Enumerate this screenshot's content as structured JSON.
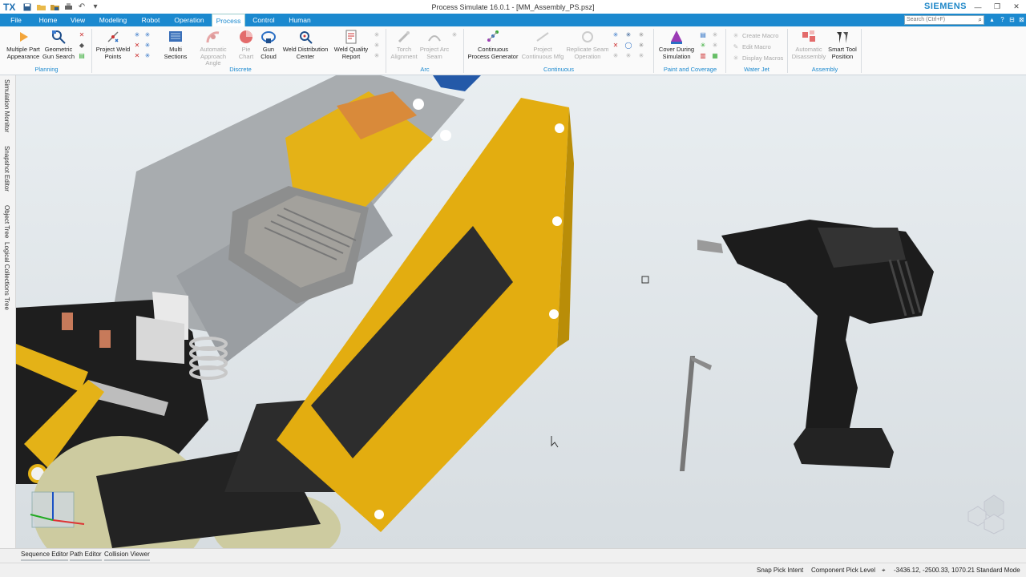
{
  "titlebar": {
    "logo": "TX",
    "window_title": "Process Simulate 16.0.1 - [MM_Assembly_PS.psz]",
    "brand": "SIEMENS"
  },
  "tabs": [
    "File",
    "Home",
    "View",
    "Modeling",
    "Robot",
    "Operation",
    "Process",
    "Control",
    "Human"
  ],
  "active_tab": "Process",
  "search": {
    "placeholder": "Search (Ctrl+F)"
  },
  "ribbon": {
    "buttons": {
      "multi_part": "Multiple Part Appearance",
      "geo_gun": "Geometric Gun Search",
      "project_weld": "Project Weld Points",
      "multi_sections": "Multi Sections",
      "auto_approach": "Automatic Approach Angle",
      "pie_chart": "Pie Chart",
      "gun_cloud": "Gun Cloud",
      "weld_dist": "Weld Distribution Center",
      "weld_quality": "Weld Quality Report",
      "torch_align": "Torch Alignment",
      "project_arc": "Project Arc Seam",
      "cont_gen": "Continuous Process Generator",
      "project_cont": "Project Continuous Mfg",
      "replicate_seam": "Replicate Seam Operation",
      "cover_sim": "Cover During Simulation",
      "create_macro": "Create Macro",
      "edit_macro": "Edit Macro",
      "display_macros": "Display Macros",
      "auto_disassembly": "Automatic Disassembly",
      "smart_tool": "Smart Tool Position"
    },
    "groups": {
      "planning": "Planning",
      "discrete": "Discrete",
      "arc": "Arc",
      "continuous": "Continuous",
      "paint": "Paint and Coverage",
      "water": "Water Jet",
      "assembly": "Assembly"
    }
  },
  "side_tabs": [
    "Simulation Monitor",
    "Snapshot Editor",
    "Object Tree",
    "Logical Collections Tree"
  ],
  "bottom_tabs": [
    "Sequence Editor",
    "Path Editor",
    "Collision Viewer"
  ],
  "status": {
    "snap": "Snap Pick Intent",
    "pick_level": "Component Pick Level",
    "coords": "-3436.12, -2500.33, 1070.21",
    "mode": "Standard Mode"
  },
  "colors": {
    "accent": "#1b89cf",
    "panel_yellow": "#e3ad10",
    "tool_black": "#1c1c1c"
  }
}
